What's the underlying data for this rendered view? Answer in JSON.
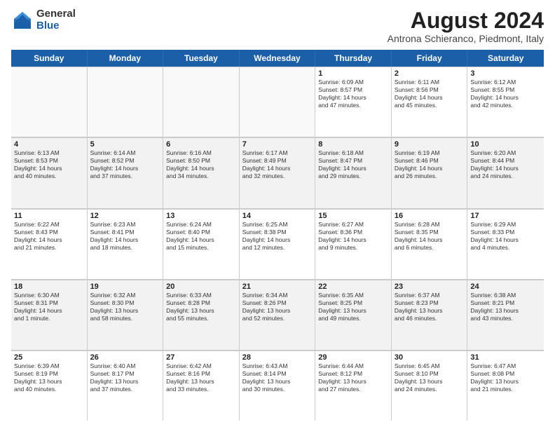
{
  "logo": {
    "general": "General",
    "blue": "Blue"
  },
  "title": "August 2024",
  "subtitle": "Antrona Schieranco, Piedmont, Italy",
  "days": [
    "Sunday",
    "Monday",
    "Tuesday",
    "Wednesday",
    "Thursday",
    "Friday",
    "Saturday"
  ],
  "weeks": [
    [
      {
        "day": "",
        "lines": []
      },
      {
        "day": "",
        "lines": []
      },
      {
        "day": "",
        "lines": []
      },
      {
        "day": "",
        "lines": []
      },
      {
        "day": "1",
        "lines": [
          "Sunrise: 6:09 AM",
          "Sunset: 8:57 PM",
          "Daylight: 14 hours",
          "and 47 minutes."
        ]
      },
      {
        "day": "2",
        "lines": [
          "Sunrise: 6:11 AM",
          "Sunset: 8:56 PM",
          "Daylight: 14 hours",
          "and 45 minutes."
        ]
      },
      {
        "day": "3",
        "lines": [
          "Sunrise: 6:12 AM",
          "Sunset: 8:55 PM",
          "Daylight: 14 hours",
          "and 42 minutes."
        ]
      }
    ],
    [
      {
        "day": "4",
        "lines": [
          "Sunrise: 6:13 AM",
          "Sunset: 8:53 PM",
          "Daylight: 14 hours",
          "and 40 minutes."
        ]
      },
      {
        "day": "5",
        "lines": [
          "Sunrise: 6:14 AM",
          "Sunset: 8:52 PM",
          "Daylight: 14 hours",
          "and 37 minutes."
        ]
      },
      {
        "day": "6",
        "lines": [
          "Sunrise: 6:16 AM",
          "Sunset: 8:50 PM",
          "Daylight: 14 hours",
          "and 34 minutes."
        ]
      },
      {
        "day": "7",
        "lines": [
          "Sunrise: 6:17 AM",
          "Sunset: 8:49 PM",
          "Daylight: 14 hours",
          "and 32 minutes."
        ]
      },
      {
        "day": "8",
        "lines": [
          "Sunrise: 6:18 AM",
          "Sunset: 8:47 PM",
          "Daylight: 14 hours",
          "and 29 minutes."
        ]
      },
      {
        "day": "9",
        "lines": [
          "Sunrise: 6:19 AM",
          "Sunset: 8:46 PM",
          "Daylight: 14 hours",
          "and 26 minutes."
        ]
      },
      {
        "day": "10",
        "lines": [
          "Sunrise: 6:20 AM",
          "Sunset: 8:44 PM",
          "Daylight: 14 hours",
          "and 24 minutes."
        ]
      }
    ],
    [
      {
        "day": "11",
        "lines": [
          "Sunrise: 6:22 AM",
          "Sunset: 8:43 PM",
          "Daylight: 14 hours",
          "and 21 minutes."
        ]
      },
      {
        "day": "12",
        "lines": [
          "Sunrise: 6:23 AM",
          "Sunset: 8:41 PM",
          "Daylight: 14 hours",
          "and 18 minutes."
        ]
      },
      {
        "day": "13",
        "lines": [
          "Sunrise: 6:24 AM",
          "Sunset: 8:40 PM",
          "Daylight: 14 hours",
          "and 15 minutes."
        ]
      },
      {
        "day": "14",
        "lines": [
          "Sunrise: 6:25 AM",
          "Sunset: 8:38 PM",
          "Daylight: 14 hours",
          "and 12 minutes."
        ]
      },
      {
        "day": "15",
        "lines": [
          "Sunrise: 6:27 AM",
          "Sunset: 8:36 PM",
          "Daylight: 14 hours",
          "and 9 minutes."
        ]
      },
      {
        "day": "16",
        "lines": [
          "Sunrise: 6:28 AM",
          "Sunset: 8:35 PM",
          "Daylight: 14 hours",
          "and 6 minutes."
        ]
      },
      {
        "day": "17",
        "lines": [
          "Sunrise: 6:29 AM",
          "Sunset: 8:33 PM",
          "Daylight: 14 hours",
          "and 4 minutes."
        ]
      }
    ],
    [
      {
        "day": "18",
        "lines": [
          "Sunrise: 6:30 AM",
          "Sunset: 8:31 PM",
          "Daylight: 14 hours",
          "and 1 minute."
        ]
      },
      {
        "day": "19",
        "lines": [
          "Sunrise: 6:32 AM",
          "Sunset: 8:30 PM",
          "Daylight: 13 hours",
          "and 58 minutes."
        ]
      },
      {
        "day": "20",
        "lines": [
          "Sunrise: 6:33 AM",
          "Sunset: 8:28 PM",
          "Daylight: 13 hours",
          "and 55 minutes."
        ]
      },
      {
        "day": "21",
        "lines": [
          "Sunrise: 6:34 AM",
          "Sunset: 8:26 PM",
          "Daylight: 13 hours",
          "and 52 minutes."
        ]
      },
      {
        "day": "22",
        "lines": [
          "Sunrise: 6:35 AM",
          "Sunset: 8:25 PM",
          "Daylight: 13 hours",
          "and 49 minutes."
        ]
      },
      {
        "day": "23",
        "lines": [
          "Sunrise: 6:37 AM",
          "Sunset: 8:23 PM",
          "Daylight: 13 hours",
          "and 46 minutes."
        ]
      },
      {
        "day": "24",
        "lines": [
          "Sunrise: 6:38 AM",
          "Sunset: 8:21 PM",
          "Daylight: 13 hours",
          "and 43 minutes."
        ]
      }
    ],
    [
      {
        "day": "25",
        "lines": [
          "Sunrise: 6:39 AM",
          "Sunset: 8:19 PM",
          "Daylight: 13 hours",
          "and 40 minutes."
        ]
      },
      {
        "day": "26",
        "lines": [
          "Sunrise: 6:40 AM",
          "Sunset: 8:17 PM",
          "Daylight: 13 hours",
          "and 37 minutes."
        ]
      },
      {
        "day": "27",
        "lines": [
          "Sunrise: 6:42 AM",
          "Sunset: 8:16 PM",
          "Daylight: 13 hours",
          "and 33 minutes."
        ]
      },
      {
        "day": "28",
        "lines": [
          "Sunrise: 6:43 AM",
          "Sunset: 8:14 PM",
          "Daylight: 13 hours",
          "and 30 minutes."
        ]
      },
      {
        "day": "29",
        "lines": [
          "Sunrise: 6:44 AM",
          "Sunset: 8:12 PM",
          "Daylight: 13 hours",
          "and 27 minutes."
        ]
      },
      {
        "day": "30",
        "lines": [
          "Sunrise: 6:45 AM",
          "Sunset: 8:10 PM",
          "Daylight: 13 hours",
          "and 24 minutes."
        ]
      },
      {
        "day": "31",
        "lines": [
          "Sunrise: 6:47 AM",
          "Sunset: 8:08 PM",
          "Daylight: 13 hours",
          "and 21 minutes."
        ]
      }
    ]
  ]
}
